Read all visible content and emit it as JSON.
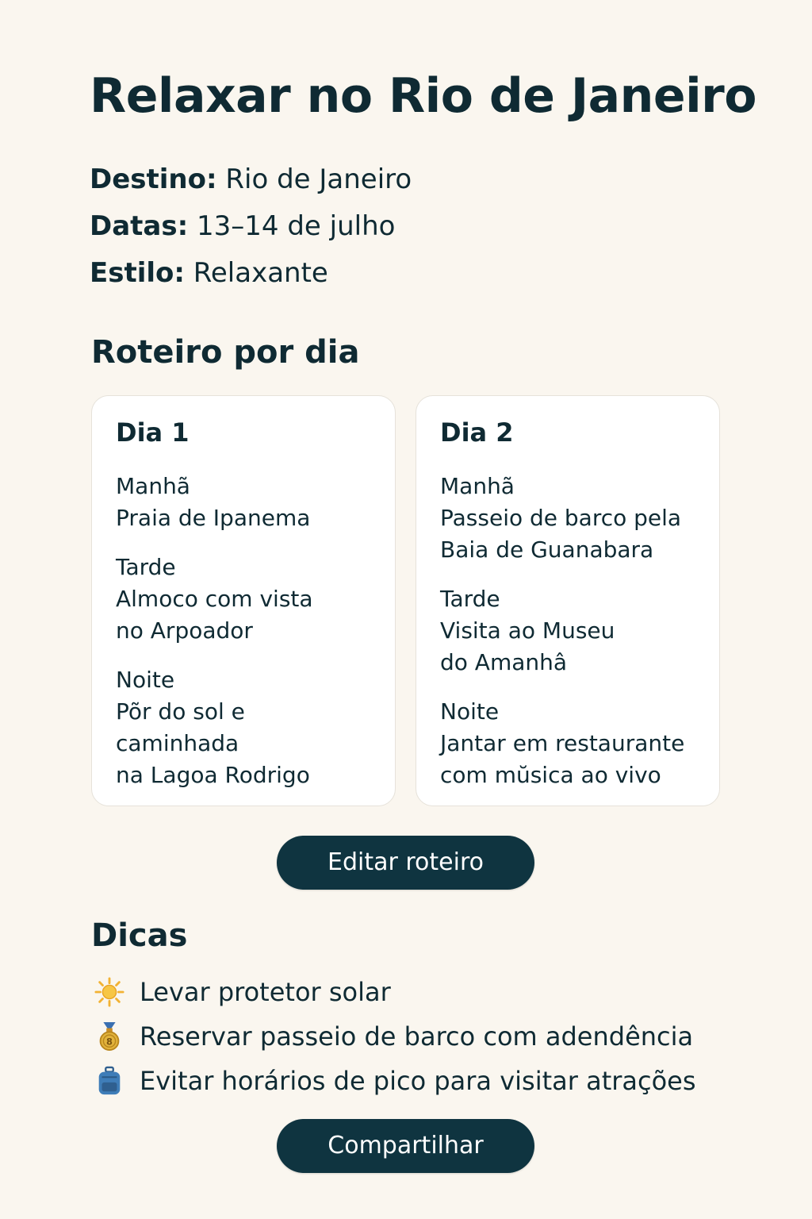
{
  "page": {
    "title": "Relaxar no Rio de Janeiro"
  },
  "details": {
    "destination_label": "Destino:",
    "destination_value": "Rio de Janeiro",
    "dates_label": "Datas:",
    "dates_value": "13–14 de julho",
    "style_label": "Estilo:",
    "style_value": "Relaxante"
  },
  "itinerary": {
    "heading": "Roteiro por dia",
    "days": [
      {
        "title": "Dia 1",
        "morning_label": "Manhã",
        "morning_line1": "Praia de Ipanema",
        "afternoon_label": "Tarde",
        "afternoon_line1": "Almoco com vista",
        "afternoon_line2": "no Arpoador",
        "night_label": "Noite",
        "night_line1": "Põr do sol e caminhada",
        "night_line2": "na Lagoa Rodrigo"
      },
      {
        "title": "Dia 2",
        "morning_label": "Manhã",
        "morning_line1": "Passeio de barco pela",
        "morning_line2": "Baia de Guanabara",
        "afternoon_label": "Tarde",
        "afternoon_line1": "Visita ao Museu",
        "afternoon_line2": "do Amanhâ",
        "night_label": "Noite",
        "night_line1": "Jantar em restaurante",
        "night_line2": "com mŭsica ao vivo"
      }
    ],
    "edit_button_label": "Editar roteiro"
  },
  "tips": {
    "heading": "Dicas",
    "items": [
      {
        "icon": "sun-icon",
        "text": "Levar protetor solar"
      },
      {
        "icon": "medal-icon",
        "text": "Reservar passeio de barco com adendência"
      },
      {
        "icon": "backpack-icon",
        "text": "Evitar horários de pico para visitar atrações"
      }
    ]
  },
  "share_button_label": "Compartilhar",
  "colors": {
    "background": "#faf6ef",
    "text": "#0f2a33",
    "button": "#0f3440",
    "card": "#ffffff"
  }
}
